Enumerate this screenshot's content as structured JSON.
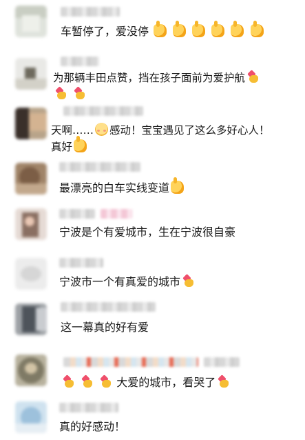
{
  "comments": [
    {
      "text": "车暂停了，爱没停",
      "emojis": [
        "ok-hand-icon",
        "ok-hand-icon",
        "ok-hand-icon",
        "ok-hand-icon",
        "ok-hand-icon",
        "ok-hand-icon"
      ]
    },
    {
      "text": "为那辆丰田点赞，挡在孩子面前为爱护航",
      "emojis_inline": [
        "finger-heart-icon"
      ],
      "emojis_line2": [
        "finger-heart-icon",
        "finger-heart-icon"
      ]
    },
    {
      "text_part1": "天啊……",
      "text_part2": "感动！宝宝遇见了这么多好心人！",
      "line2": "真好",
      "emojis": [
        "blush-face-icon",
        "ok-hand-icon"
      ]
    },
    {
      "text": "最漂亮的白车实线变道",
      "emojis": [
        "ok-hand-icon"
      ]
    },
    {
      "text": "宁波是个有爱城市，生在宁波很自豪"
    },
    {
      "text": "宁波市一个有真爱的城市",
      "emojis": [
        "finger-heart-icon"
      ]
    },
    {
      "text": "这一幕真的好有爱"
    },
    {
      "text": "大爱的城市，看哭了",
      "emojis_lead": [
        "finger-heart-icon",
        "finger-heart-icon",
        "finger-heart-icon"
      ],
      "emojis_tail": [
        "finger-heart-icon"
      ]
    },
    {
      "text": "真的好感动！"
    }
  ],
  "colors": {
    "text": "#1a1a1a",
    "background": "#ffffff"
  }
}
